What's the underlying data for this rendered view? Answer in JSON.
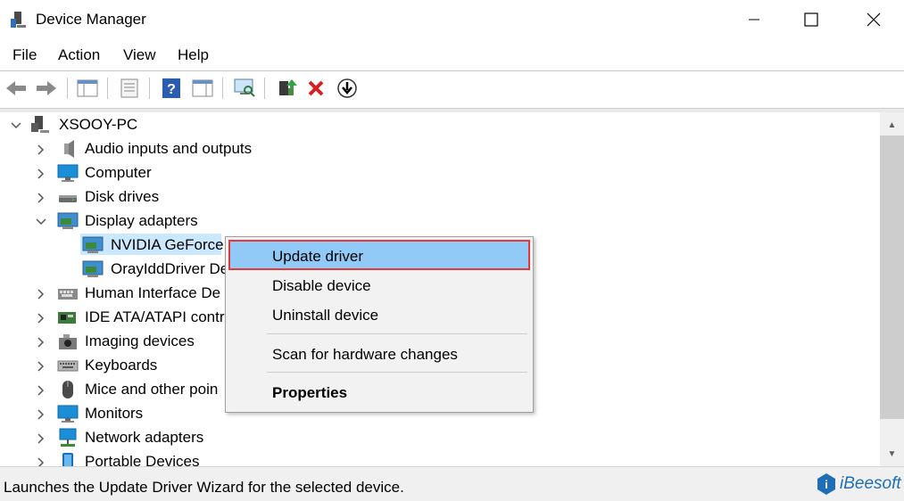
{
  "window": {
    "title": "Device Manager",
    "app_icon": "device-manager-icon"
  },
  "menu": [
    "File",
    "Action",
    "View",
    "Help"
  ],
  "toolbar": {
    "buttons": [
      "back-icon",
      "forward-icon",
      "show-hide-console-tree-icon",
      "properties-icon",
      "help-icon",
      "action-pane-icon",
      "scan-hardware-icon",
      "update-driver-icon",
      "uninstall-icon",
      "disable-icon"
    ]
  },
  "tree": {
    "root": "XSOOY-PC",
    "items": [
      {
        "label": "Audio inputs and outputs",
        "icon": "speaker-icon",
        "expanded": false
      },
      {
        "label": "Computer",
        "icon": "computer-icon",
        "expanded": false
      },
      {
        "label": "Disk drives",
        "icon": "disk-drive-icon",
        "expanded": false
      },
      {
        "label": "Display adapters",
        "icon": "display-adapter-icon",
        "expanded": true,
        "children": [
          {
            "label": "NVIDIA GeForce",
            "icon": "display-adapter-icon",
            "selected": true
          },
          {
            "label": "OrayIddDriver De",
            "icon": "display-adapter-icon"
          }
        ]
      },
      {
        "label": "Human Interface De",
        "icon": "hid-icon",
        "expanded": false
      },
      {
        "label": "IDE ATA/ATAPI contro",
        "icon": "ide-controller-icon",
        "expanded": false
      },
      {
        "label": "Imaging devices",
        "icon": "camera-icon",
        "expanded": false
      },
      {
        "label": "Keyboards",
        "icon": "keyboard-icon",
        "expanded": false
      },
      {
        "label": "Mice and other poin",
        "icon": "mouse-icon",
        "expanded": false
      },
      {
        "label": "Monitors",
        "icon": "monitor-icon",
        "expanded": false
      },
      {
        "label": "Network adapters",
        "icon": "network-adapter-icon",
        "expanded": false
      },
      {
        "label": "Portable Devices",
        "icon": "portable-device-icon",
        "expanded": false
      }
    ]
  },
  "context_menu": {
    "items": [
      "Update driver",
      "Disable device",
      "Uninstall device",
      "Scan for hardware changes",
      "Properties"
    ],
    "highlighted": "Update driver",
    "default_bold": "Properties"
  },
  "status": {
    "text": "Launches the Update Driver Wizard for the selected device."
  },
  "brand": {
    "name": "iBeesoft"
  },
  "colors": {
    "selection": "#cce8ff",
    "menu_highlight": "#91c9f7",
    "highlight_border": "#e03a3a",
    "brand": "#1f6fb7"
  }
}
